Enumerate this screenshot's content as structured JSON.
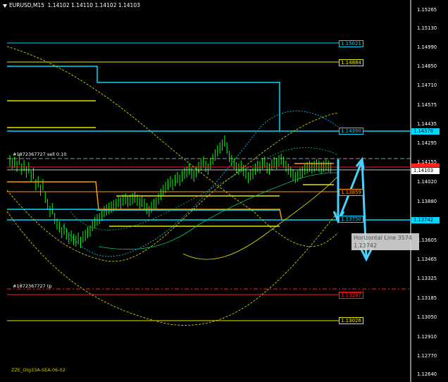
{
  "header": {
    "symbol": "EURUSD,M15",
    "ohlc": "1.14102 1.14110 1.14102 1.14103"
  },
  "orders": {
    "sell_label": "#1872367727 sell 0.10",
    "tp_label": "#1872367727 tp"
  },
  "levels": [
    {
      "value": "1.15021",
      "color": "#00d8ff"
    },
    {
      "value": "1.14884",
      "color": "#e6e600"
    },
    {
      "value": "1.14390",
      "color": "#00d8ff"
    },
    {
      "value": "1.13859",
      "color": "#ff9900"
    },
    {
      "value": "1.13750",
      "color": "#00d8ff"
    },
    {
      "value": "1.13287",
      "color": "#ff2020"
    },
    {
      "value": "1.13026",
      "color": "#e6e600"
    }
  ],
  "price_axis": {
    "ticks": [
      "1.15265",
      "1.15130",
      "1.14990",
      "1.14850",
      "1.14710",
      "1.14575",
      "1.14435",
      "1.14295",
      "1.14155",
      "1.14020",
      "1.13880",
      "1.13605",
      "1.13465",
      "1.13325",
      "1.13185",
      "1.13050",
      "1.12910",
      "1.12770",
      "1.12640"
    ],
    "tags": [
      {
        "text": "1.14378",
        "color": "#00d8ff",
        "textcolor": "#000"
      },
      {
        "text": "1.14103",
        "color": "#ffffff",
        "textcolor": "#000"
      },
      {
        "text": "1.13742",
        "color": "#00d8ff",
        "textcolor": "#000"
      }
    ]
  },
  "tooltip": {
    "line1": "Horizontal Line 3574",
    "line2": "1.13742"
  },
  "footer": "ZZE_Otg33A-SEA-06-02",
  "colors": {
    "background": "#000000",
    "candles": "#00ff00",
    "cyan": "#00d8ff",
    "yellow": "#e6e600",
    "orange": "#ff9900",
    "red": "#ff2020",
    "arrows": "#44d4ff"
  }
}
